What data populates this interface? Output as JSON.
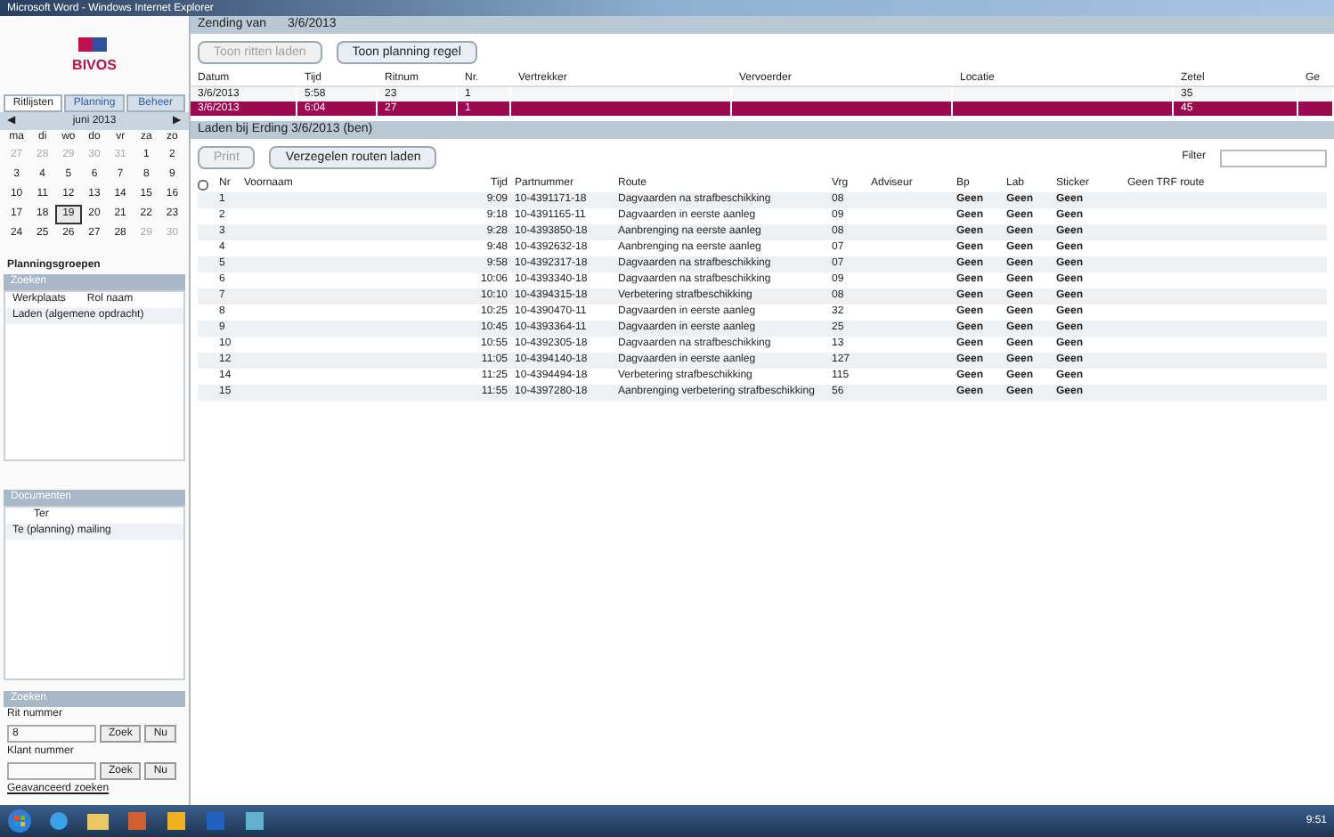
{
  "window": {
    "title": "Microsoft Word - Windows Internet Explorer"
  },
  "sidebar": {
    "logo": "BIVOS",
    "tabs": [
      {
        "label": "Ritlijsten",
        "selected": true
      },
      {
        "label": "Planning",
        "selected": false
      },
      {
        "label": "Beheer",
        "selected": false
      }
    ],
    "calendar": {
      "prev": "◀",
      "month": "juni 2013",
      "next": "▶",
      "weekdays": [
        "ma",
        "di",
        "wo",
        "do",
        "vr",
        "za",
        "zo"
      ],
      "weeks": [
        [
          {
            "day": "27",
            "muted": true,
            "selected": false
          },
          {
            "day": "28",
            "muted": true,
            "selected": false
          },
          {
            "day": "29",
            "muted": true,
            "selected": false
          },
          {
            "day": "30",
            "muted": true,
            "selected": false
          },
          {
            "day": "31",
            "muted": true,
            "selected": false
          },
          {
            "day": "1",
            "muted": false,
            "selected": false
          },
          {
            "day": "2",
            "muted": false,
            "selected": false
          }
        ],
        [
          {
            "day": "3",
            "muted": false,
            "selected": false
          },
          {
            "day": "4",
            "muted": false,
            "selected": false
          },
          {
            "day": "5",
            "muted": false,
            "selected": false
          },
          {
            "day": "6",
            "muted": false,
            "selected": false
          },
          {
            "day": "7",
            "muted": false,
            "selected": false
          },
          {
            "day": "8",
            "muted": false,
            "selected": false
          },
          {
            "day": "9",
            "muted": false,
            "selected": false
          }
        ],
        [
          {
            "day": "10",
            "muted": false,
            "selected": false
          },
          {
            "day": "11",
            "muted": false,
            "selected": false
          },
          {
            "day": "12",
            "muted": false,
            "selected": false
          },
          {
            "day": "13",
            "muted": false,
            "selected": false
          },
          {
            "day": "14",
            "muted": false,
            "selected": false
          },
          {
            "day": "15",
            "muted": false,
            "selected": false
          },
          {
            "day": "16",
            "muted": false,
            "selected": false
          }
        ],
        [
          {
            "day": "17",
            "muted": false,
            "selected": false
          },
          {
            "day": "18",
            "muted": false,
            "selected": false
          },
          {
            "day": "19",
            "muted": false,
            "selected": true
          },
          {
            "day": "20",
            "muted": false,
            "selected": false
          },
          {
            "day": "21",
            "muted": false,
            "selected": false
          },
          {
            "day": "22",
            "muted": false,
            "selected": false
          },
          {
            "day": "23",
            "muted": false,
            "selected": false
          }
        ],
        [
          {
            "day": "24",
            "muted": false,
            "selected": false
          },
          {
            "day": "25",
            "muted": false,
            "selected": false
          },
          {
            "day": "26",
            "muted": false,
            "selected": false
          },
          {
            "day": "27",
            "muted": false,
            "selected": false
          },
          {
            "day": "28",
            "muted": false,
            "selected": false
          },
          {
            "day": "29",
            "muted": true,
            "selected": false
          },
          {
            "day": "30",
            "muted": true,
            "selected": false
          }
        ]
      ]
    },
    "groups": {
      "title": "Planningsgroepen",
      "header": "Zoeken",
      "columns": [
        "Werkplaats",
        "Rol naam"
      ],
      "items": [
        "Laden (algemene opdracht)"
      ]
    },
    "documents": {
      "header": "Documenten",
      "value": "Ter",
      "items": [
        "Te (planning) mailing"
      ]
    },
    "search": {
      "header": "Zoeken",
      "rit_label": "Rit nummer",
      "rit_value": "8",
      "rit_buttons": [
        "Zoek",
        "Nu"
      ],
      "klant_label": "Klant nummer",
      "klant_buttons": [
        "Zoek",
        "Nu"
      ],
      "advanced": "Geavanceerd zoeken"
    }
  },
  "top": {
    "title": "Zending van",
    "date": "3/6/2013",
    "buttons": [
      {
        "label": "Toon ritten laden",
        "disabled": true
      },
      {
        "label": "Toon planning regel",
        "disabled": false
      }
    ],
    "columns": [
      "Datum",
      "Tijd",
      "Ritnum",
      "Nr.",
      "Vertrekker",
      "Vervoerder",
      "Locatie",
      "Zetel",
      "Ge"
    ],
    "rows": [
      {
        "selected": false,
        "cells": [
          "3/6/2013",
          "5:58",
          "23",
          "1",
          "",
          "",
          "",
          "35",
          ""
        ]
      },
      {
        "selected": true,
        "cells": [
          "3/6/2013",
          "6:04",
          "27",
          "1",
          "",
          "",
          "",
          "45",
          ""
        ]
      }
    ]
  },
  "loading": {
    "title": "Laden bij Erding 3/6/2013 (ben)",
    "buttons": [
      {
        "label": "Print",
        "disabled": true
      },
      {
        "label": "Verzegelen routen laden",
        "disabled": false
      }
    ],
    "filter_label": "Filter",
    "select_all": {
      "checked": false
    },
    "columns": [
      "Nr",
      "Voornaam",
      "Tijd",
      "Partnummer",
      "Route",
      "Vrg",
      "Adviseur",
      "Bp",
      "Lab",
      "Sticker",
      "Geen TRF route"
    ],
    "rows": [
      [
        "1",
        "",
        "9:09",
        "10-4391171-18",
        "Dagvaarden na strafbeschikking",
        "08",
        "",
        "Geen",
        "Geen",
        "Geen",
        ""
      ],
      [
        "2",
        "",
        "9:18",
        "10-4391165-11",
        "Dagvaarden in eerste aanleg",
        "09",
        "",
        "Geen",
        "Geen",
        "Geen",
        ""
      ],
      [
        "3",
        "",
        "9:28",
        "10-4393850-18",
        "Aanbrenging na eerste aanleg",
        "08",
        "",
        "Geen",
        "Geen",
        "Geen",
        ""
      ],
      [
        "4",
        "",
        "9:48",
        "10-4392632-18",
        "Aanbrenging na eerste aanleg",
        "07",
        "",
        "Geen",
        "Geen",
        "Geen",
        ""
      ],
      [
        "5",
        "",
        "9:58",
        "10-4392317-18",
        "Dagvaarden na strafbeschikking",
        "07",
        "",
        "Geen",
        "Geen",
        "Geen",
        ""
      ],
      [
        "6",
        "",
        "10:06",
        "10-4393340-18",
        "Dagvaarden na strafbeschikking",
        "09",
        "",
        "Geen",
        "Geen",
        "Geen",
        ""
      ],
      [
        "7",
        "",
        "10:10",
        "10-4394315-18",
        "Verbetering strafbeschikking",
        "08",
        "",
        "Geen",
        "Geen",
        "Geen",
        ""
      ],
      [
        "8",
        "",
        "10:25",
        "10-4390470-11",
        "Dagvaarden in eerste aanleg",
        "32",
        "",
        "Geen",
        "Geen",
        "Geen",
        ""
      ],
      [
        "9",
        "",
        "10:45",
        "10-4393364-11",
        "Dagvaarden in eerste aanleg",
        "25",
        "",
        "Geen",
        "Geen",
        "Geen",
        ""
      ],
      [
        "10",
        "",
        "10:55",
        "10-4392305-18",
        "Dagvaarden na strafbeschikking",
        "13",
        "",
        "Geen",
        "Geen",
        "Geen",
        ""
      ],
      [
        "12",
        "",
        "11:05",
        "10-4394140-18",
        "Dagvaarden in eerste aanleg",
        "127",
        "",
        "Geen",
        "Geen",
        "Geen",
        ""
      ],
      [
        "14",
        "",
        "11:25",
        "10-4394494-18",
        "Verbetering strafbeschikking",
        "115",
        "",
        "Geen",
        "Geen",
        "Geen",
        ""
      ],
      [
        "15",
        "",
        "11:55",
        "10-4397280-18",
        "Aanbrenging verbetering strafbeschikking",
        "56",
        "",
        "Geen",
        "Geen",
        "Geen",
        ""
      ]
    ]
  },
  "taskbar": {
    "time": "9:51"
  }
}
